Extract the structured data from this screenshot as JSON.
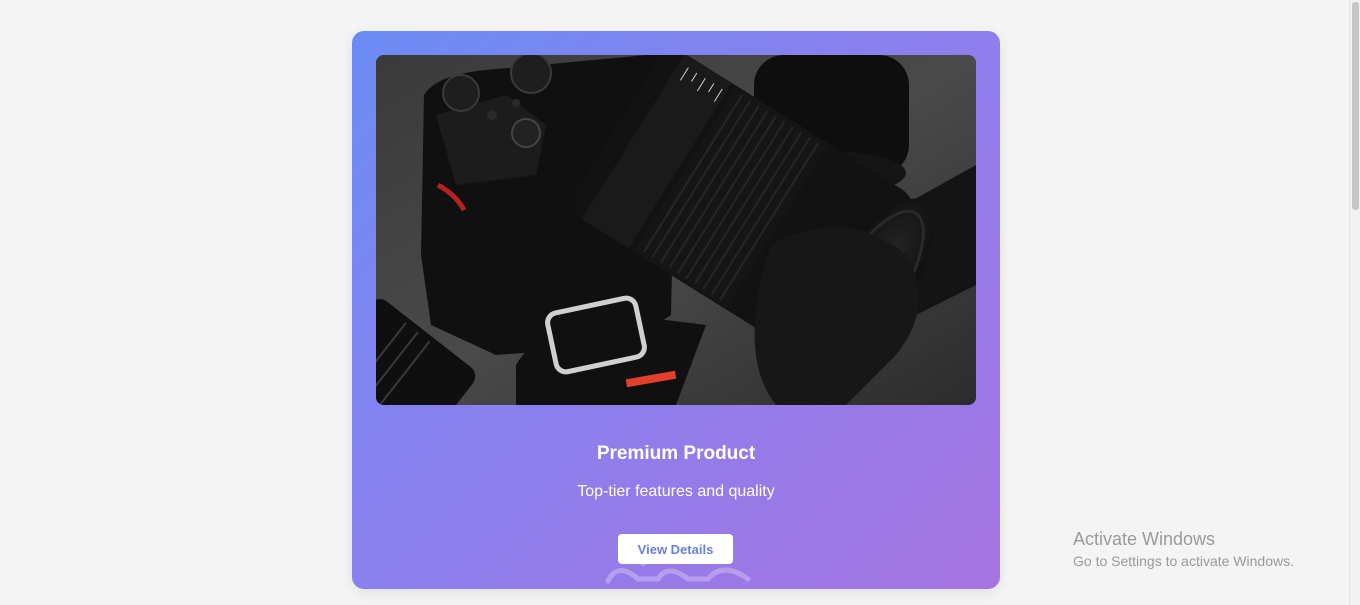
{
  "card": {
    "image_alt": "Camera with lens",
    "title": "Premium Product",
    "description": "Top-tier features and quality",
    "button_label": "View Details"
  },
  "os_notice": {
    "title": "Activate Windows",
    "subtitle": "Go to Settings to activate Windows."
  },
  "colors": {
    "page_background": "#f4f4f4",
    "card_gradient_start": "#6b8cf5",
    "card_gradient_end": "#a674e0",
    "button_text": "#6a7fdc"
  }
}
